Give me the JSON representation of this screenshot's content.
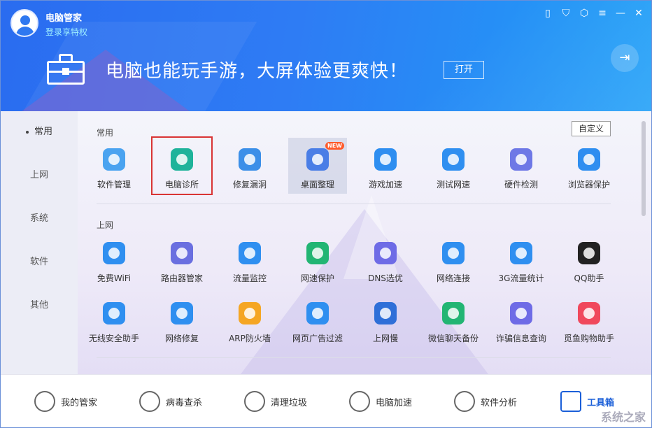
{
  "header": {
    "app_name": "电脑管家",
    "login_link": "登录享特权",
    "banner_text": "电脑也能玩手游，大屏体验更爽快！",
    "open_button": "打开",
    "window_controls": [
      "phone-icon",
      "shield-icon",
      "shirt-icon",
      "menu-icon",
      "minimize-icon",
      "close-icon"
    ]
  },
  "sidebar": {
    "items": [
      {
        "label": "常用",
        "active": true
      },
      {
        "label": "上网",
        "active": false
      },
      {
        "label": "系统",
        "active": false
      },
      {
        "label": "软件",
        "active": false
      },
      {
        "label": "其他",
        "active": false
      }
    ]
  },
  "main": {
    "customize_button": "自定义",
    "sections": [
      {
        "title": "常用",
        "tools": [
          {
            "label": "软件管理",
            "icon": "clover-icon",
            "color": "#4aa3f0"
          },
          {
            "label": "电脑诊所",
            "icon": "stethoscope-icon",
            "color": "#1fb39a",
            "selected": true
          },
          {
            "label": "修复漏洞",
            "icon": "windows-repair-icon",
            "color": "#3b8fe8"
          },
          {
            "label": "桌面整理",
            "icon": "desktop-organize-icon",
            "color": "#4a7ee6",
            "badge": "NEW",
            "highlight": true
          },
          {
            "label": "游戏加速",
            "icon": "game-rocket-icon",
            "color": "#2e8ef0"
          },
          {
            "label": "测试网速",
            "icon": "speedometer-icon",
            "color": "#2f8ff0"
          },
          {
            "label": "硬件检测",
            "icon": "chip-icon",
            "color": "#6e78e6"
          },
          {
            "label": "浏览器保护",
            "icon": "browser-shield-icon",
            "color": "#2e8ef0"
          }
        ]
      },
      {
        "title": "上网",
        "tools": [
          {
            "label": "免费WiFi",
            "icon": "wifi-free-icon",
            "color": "#2f8ff0"
          },
          {
            "label": "路由器管家",
            "icon": "router-icon",
            "color": "#6a6fe0"
          },
          {
            "label": "流量监控",
            "icon": "traffic-monitor-icon",
            "color": "#2f8ff0"
          },
          {
            "label": "网速保护",
            "icon": "speed-shield-icon",
            "color": "#22b573"
          },
          {
            "label": "DNS选优",
            "icon": "dns-server-icon",
            "color": "#6e6be6"
          },
          {
            "label": "网络连接",
            "icon": "globe-icon",
            "color": "#2f8ff0"
          },
          {
            "label": "3G流量统计",
            "icon": "3g-icon",
            "color": "#2f8ff0"
          },
          {
            "label": "QQ助手",
            "icon": "qq-penguin-icon",
            "color": "#222222"
          }
        ]
      },
      {
        "title": "",
        "tools": [
          {
            "label": "无线安全助手",
            "icon": "wifi-shield-icon",
            "color": "#2f8ff0"
          },
          {
            "label": "网络修复",
            "icon": "hammer-icon",
            "color": "#2f8ff0"
          },
          {
            "label": "ARP防火墙",
            "icon": "firewall-icon",
            "color": "#f5a623"
          },
          {
            "label": "网页广告过滤",
            "icon": "ad-filter-icon",
            "color": "#2f8ff0"
          },
          {
            "label": "上网慢",
            "icon": "hourglass-icon",
            "color": "#2f6fd8"
          },
          {
            "label": "微信聊天备份",
            "icon": "wechat-icon",
            "color": "#22b573"
          },
          {
            "label": "诈骗信息查询",
            "icon": "fraud-search-icon",
            "color": "#6e6be6"
          },
          {
            "label": "觅鱼购物助手",
            "icon": "shopping-tag-icon",
            "color": "#f0485c"
          }
        ]
      }
    ]
  },
  "bottom_bar": {
    "items": [
      {
        "label": "我的管家",
        "icon": "butler-icon",
        "active": false
      },
      {
        "label": "病毒查杀",
        "icon": "virus-scan-icon",
        "active": false
      },
      {
        "label": "清理垃圾",
        "icon": "vacuum-icon",
        "active": false
      },
      {
        "label": "电脑加速",
        "icon": "rocket-icon",
        "active": false
      },
      {
        "label": "软件分析",
        "icon": "software-analysis-icon",
        "active": false
      },
      {
        "label": "工具箱",
        "icon": "toolbox-icon",
        "active": true
      }
    ]
  }
}
